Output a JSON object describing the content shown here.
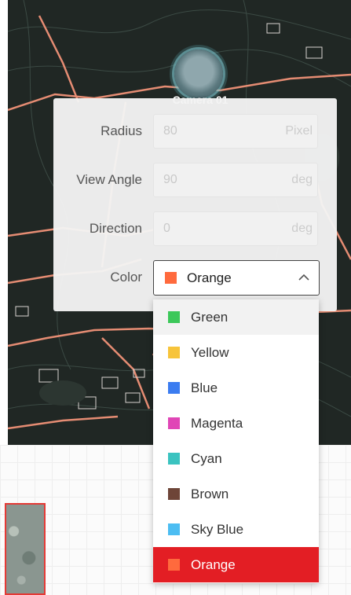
{
  "camera": {
    "label": "Camera 01"
  },
  "form": {
    "radius": {
      "label": "Radius",
      "value": "80",
      "unit": "Pixel"
    },
    "view_angle": {
      "label": "View Angle",
      "value": "90",
      "unit": "deg"
    },
    "direction": {
      "label": "Direction",
      "value": "0",
      "unit": "deg"
    },
    "color": {
      "label": "Color",
      "selected": {
        "label": "Orange",
        "color": "#ff6a3d"
      }
    }
  },
  "dropdown": {
    "options": [
      {
        "label": "Green",
        "color": "#3cc85a"
      },
      {
        "label": "Yellow",
        "color": "#f7c43a"
      },
      {
        "label": "Blue",
        "color": "#3b7cf0"
      },
      {
        "label": "Magenta",
        "color": "#e046b6"
      },
      {
        "label": "Cyan",
        "color": "#3bc3c0"
      },
      {
        "label": "Brown",
        "color": "#6e4538"
      },
      {
        "label": "Sky Blue",
        "color": "#4cbdf2"
      },
      {
        "label": "Orange",
        "color": "#ff6a3d"
      }
    ],
    "selected_option": "Orange",
    "hovered_option": "Green"
  },
  "colors": {
    "accent_red": "#e31e24",
    "map_background": "#202724",
    "map_roads": "#e58c73"
  }
}
